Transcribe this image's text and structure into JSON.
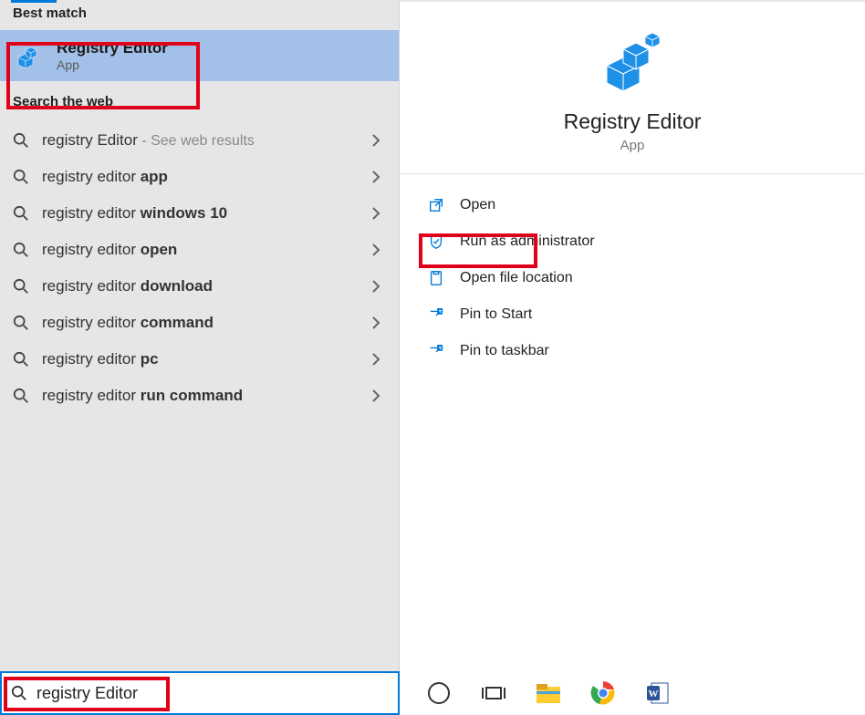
{
  "sections": {
    "best_match_label": "Best match",
    "search_web_label": "Search the web"
  },
  "best_match": {
    "title": "Registry Editor",
    "subtitle": "App"
  },
  "web_results": [
    {
      "prefix": "registry Editor",
      "bold": "",
      "hint": " - See web results"
    },
    {
      "prefix": "registry editor ",
      "bold": "app",
      "hint": ""
    },
    {
      "prefix": "registry editor ",
      "bold": "windows 10",
      "hint": ""
    },
    {
      "prefix": "registry editor ",
      "bold": "open",
      "hint": ""
    },
    {
      "prefix": "registry editor ",
      "bold": "download",
      "hint": ""
    },
    {
      "prefix": "registry editor ",
      "bold": "command",
      "hint": ""
    },
    {
      "prefix": "registry editor ",
      "bold": "pc",
      "hint": ""
    },
    {
      "prefix": "registry editor ",
      "bold": "run command",
      "hint": ""
    }
  ],
  "detail": {
    "title": "Registry Editor",
    "subtitle": "App",
    "actions": [
      {
        "icon": "open",
        "label": "Open"
      },
      {
        "icon": "admin",
        "label": "Run as administrator"
      },
      {
        "icon": "folder",
        "label": "Open file location"
      },
      {
        "icon": "pin-start",
        "label": "Pin to Start"
      },
      {
        "icon": "pin-taskbar",
        "label": "Pin to taskbar"
      }
    ]
  },
  "search_input": {
    "value": "registry Editor"
  },
  "taskbar_icons": [
    "cortana",
    "task-view",
    "file-explorer",
    "chrome",
    "word"
  ]
}
